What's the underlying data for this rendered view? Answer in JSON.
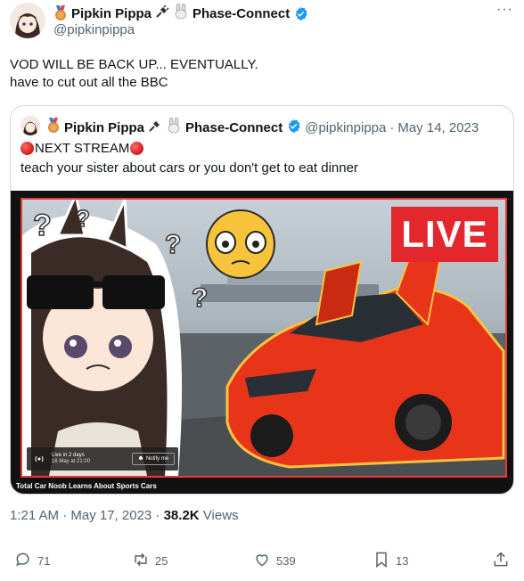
{
  "tweet": {
    "author_name": "Pipkin Pippa",
    "author_suffix": "Phase-Connect",
    "handle": "@pipkinpippa",
    "more_label": "···",
    "text_line1": "VOD WILL BE BACK UP... EVENTUALLY.",
    "text_line2": "have to cut out all the BBC",
    "timestamp": "1:21 AM · May 17, 2023 · ",
    "views_count": "38.2K",
    "views_label": " Views"
  },
  "quote": {
    "author_name": "Pipkin Pippa",
    "author_suffix": "Phase-Connect",
    "handle": "@pipkinpippa",
    "separator": "·",
    "date": "May 14, 2023",
    "line1": "NEXT STREAM",
    "line2": "teach your sister about cars or you don't get to eat dinner",
    "media": {
      "live_label": "LIVE",
      "caption": "Total Car Noob Learns About Sports Cars",
      "live_in": "Live in 2 days",
      "live_date": "16 May at 21:00",
      "notify": "Notify me"
    }
  },
  "actions": {
    "replies": "71",
    "retweets": "25",
    "likes": "539",
    "bookmarks": "13"
  },
  "colors": {
    "verified": "#1d9bf0",
    "text_secondary": "#536471",
    "live_red": "#e4262d"
  },
  "icons": [
    "medal-icon",
    "plug-icon",
    "rabbit-icon",
    "verified-icon",
    "reply-icon",
    "retweet-icon",
    "like-icon",
    "bookmark-icon",
    "share-icon"
  ]
}
